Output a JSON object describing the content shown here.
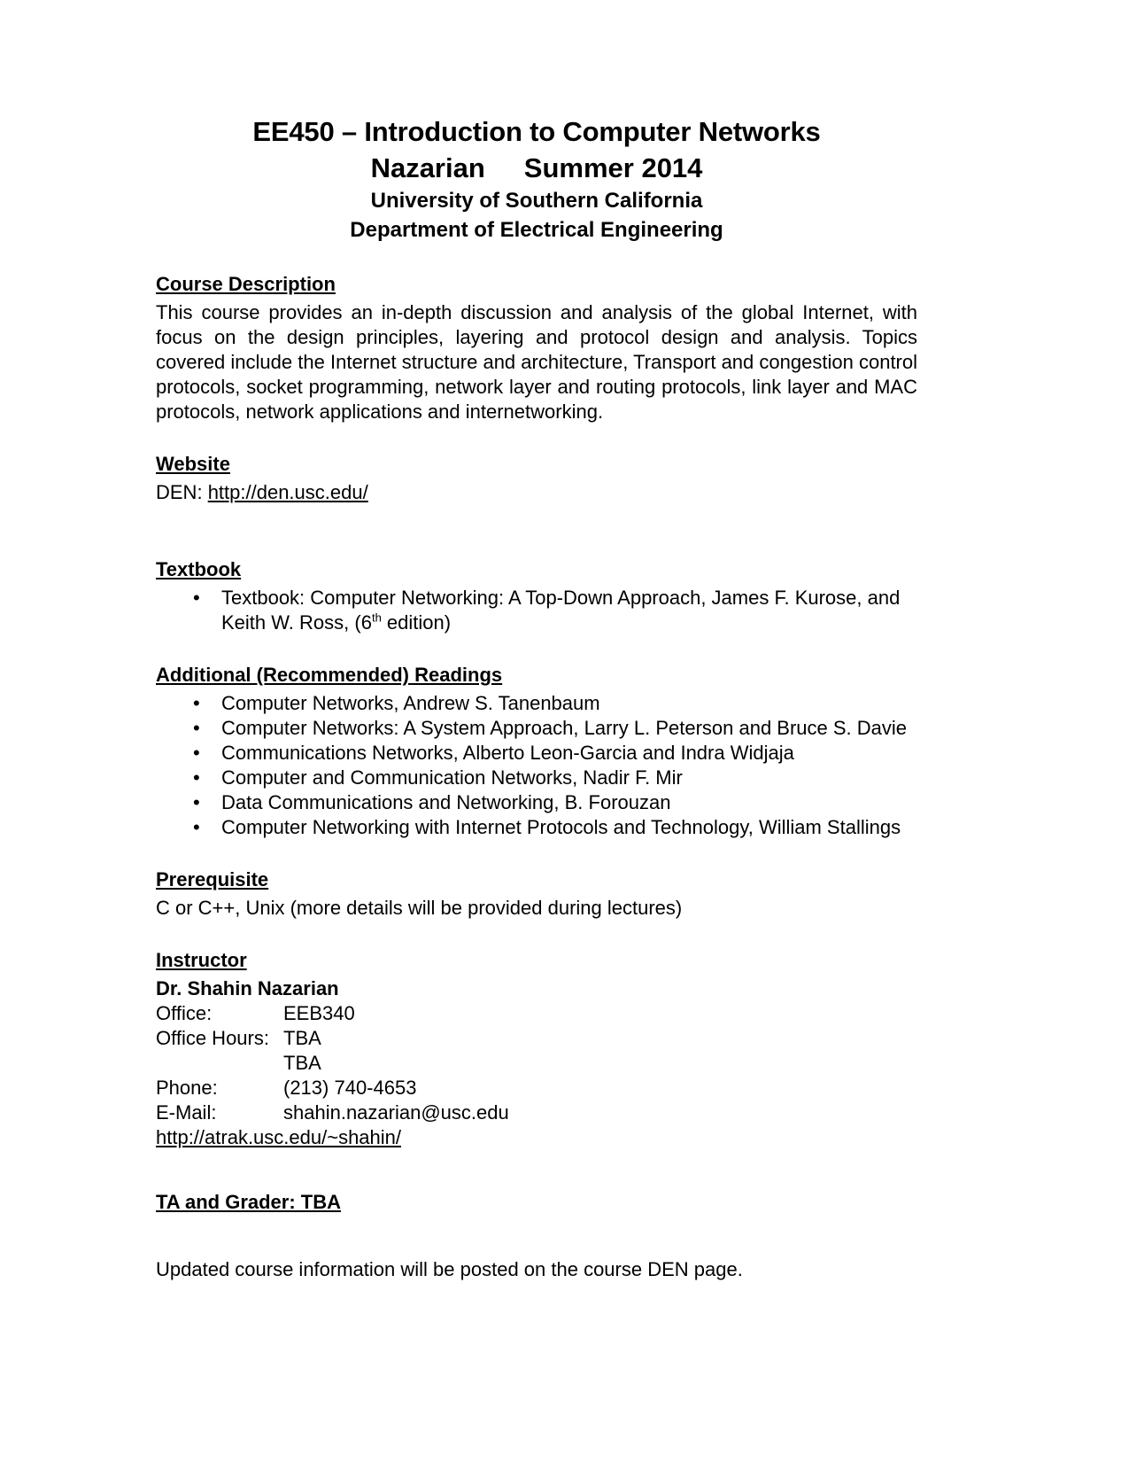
{
  "title": {
    "course": "EE450 – Introduction to Computer Networks",
    "instructor_last": "Nazarian",
    "term": "Summer 2014",
    "university": "University of Southern California",
    "department": "Department of Electrical Engineering"
  },
  "course_description": {
    "heading": "Course Description",
    "text": "This course provides an in-depth discussion and analysis of the global Internet, with focus on the design principles, layering and protocol design and analysis. Topics covered include the Internet structure and architecture, Transport and congestion control protocols, socket programming, network layer and routing protocols, link layer and MAC protocols, network applications and internetworking."
  },
  "website": {
    "heading": "Website",
    "label": "DEN: ",
    "url": "http://den.usc.edu/"
  },
  "textbook": {
    "heading": "Textbook",
    "item_part1": "Textbook: Computer Networking: A Top-Down Approach, James F. Kurose, and Keith W. Ross, (6",
    "ordinal": "th",
    "item_part2": " edition)"
  },
  "readings": {
    "heading": "Additional (Recommended) Readings",
    "items": [
      "Computer Networks, Andrew S. Tanenbaum",
      "Computer Networks: A System Approach, Larry L. Peterson and Bruce S. Davie",
      "Communications Networks, Alberto Leon-Garcia and Indra Widjaja",
      "Computer and Communication Networks, Nadir F. Mir",
      "Data Communications and Networking, B. Forouzan",
      "Computer Networking with Internet Protocols and Technology, William Stallings"
    ],
    "bullet_glyph": "•"
  },
  "prerequisite": {
    "heading": "Prerequisite",
    "text": "C or C++, Unix (more details will be provided during lectures)"
  },
  "instructor": {
    "heading": "Instructor",
    "name": "Dr. Shahin Nazarian",
    "office_label": "Office:",
    "office_value": "EEB340",
    "office_hours_label": "Office Hours:",
    "office_hours_value": "TBA",
    "office_hours_value2": "TBA",
    "phone_label": "Phone:",
    "phone_value": "(213) 740-4653",
    "email_label": "E-Mail:",
    "email_value": "shahin.nazarian@usc.edu",
    "homepage_url": "http://atrak.usc.edu/~shahin/"
  },
  "ta": {
    "heading": "TA and Grader: TBA"
  },
  "footer": {
    "note": "Updated course information will be posted on the course DEN page."
  }
}
